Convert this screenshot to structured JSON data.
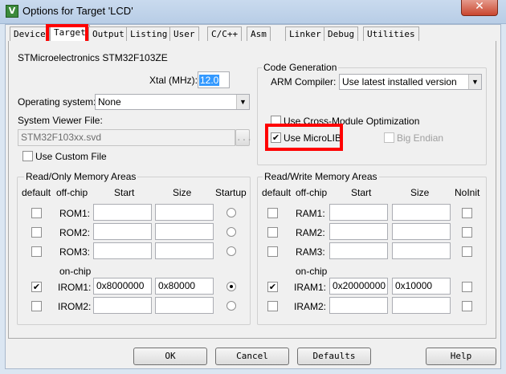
{
  "window": {
    "title": "Options for Target 'LCD'",
    "close_glyph": "✕",
    "app_icon_glyph": "V"
  },
  "tabs": [
    {
      "label": "Device"
    },
    {
      "label": "Target",
      "active": true
    },
    {
      "label": "Output"
    },
    {
      "label": "Listing"
    },
    {
      "label": "User"
    },
    {
      "label": "C/C++"
    },
    {
      "label": "Asm"
    },
    {
      "label": "Linker"
    },
    {
      "label": "Debug"
    },
    {
      "label": "Utilities"
    }
  ],
  "target": {
    "device_name": "STMicroelectronics STM32F103ZE",
    "xtal_label": "Xtal (MHz):",
    "xtal_value": "12.0",
    "os_label": "Operating system:",
    "os_value": "None",
    "svd_label": "System Viewer File:",
    "svd_value": "STM32F103xx.svd",
    "svd_browse": "...",
    "custom_file_label": "Use Custom File",
    "custom_file_checked": false
  },
  "code_generation": {
    "title": "Code Generation",
    "compiler_label": "ARM Compiler:",
    "compiler_value": "Use latest installed version",
    "cross_module_label": "Use Cross-Module Optimization",
    "cross_module_checked": false,
    "microlib_label": "Use MicroLIB",
    "microlib_checked": true,
    "big_endian_label": "Big Endian",
    "big_endian_checked": false
  },
  "rom": {
    "title": "Read/Only Memory Areas",
    "headers": {
      "default": "default",
      "offchip": "off-chip",
      "start": "Start",
      "size": "Size",
      "startup": "Startup"
    },
    "onchip_label": "on-chip",
    "rows": [
      {
        "name": "ROM1:",
        "default": false,
        "start": "",
        "size": "",
        "startup": false
      },
      {
        "name": "ROM2:",
        "default": false,
        "start": "",
        "size": "",
        "startup": false
      },
      {
        "name": "ROM3:",
        "default": false,
        "start": "",
        "size": "",
        "startup": false
      },
      {
        "name": "IROM1:",
        "default": true,
        "start": "0x8000000",
        "size": "0x80000",
        "startup": true
      },
      {
        "name": "IROM2:",
        "default": false,
        "start": "",
        "size": "",
        "startup": false
      }
    ]
  },
  "ram": {
    "title": "Read/Write Memory Areas",
    "headers": {
      "default": "default",
      "offchip": "off-chip",
      "start": "Start",
      "size": "Size",
      "noinit": "NoInit"
    },
    "onchip_label": "on-chip",
    "rows": [
      {
        "name": "RAM1:",
        "default": false,
        "start": "",
        "size": "",
        "noinit": false
      },
      {
        "name": "RAM2:",
        "default": false,
        "start": "",
        "size": "",
        "noinit": false
      },
      {
        "name": "RAM3:",
        "default": false,
        "start": "",
        "size": "",
        "noinit": false
      },
      {
        "name": "IRAM1:",
        "default": true,
        "start": "0x20000000",
        "size": "0x10000",
        "noinit": false
      },
      {
        "name": "IRAM2:",
        "default": false,
        "start": "",
        "size": "",
        "noinit": false
      }
    ]
  },
  "buttons": {
    "ok": "OK",
    "cancel": "Cancel",
    "defaults": "Defaults",
    "help": "Help"
  },
  "colors": {
    "highlight": "#ff0000",
    "selected_text_bg": "#3399ff"
  }
}
